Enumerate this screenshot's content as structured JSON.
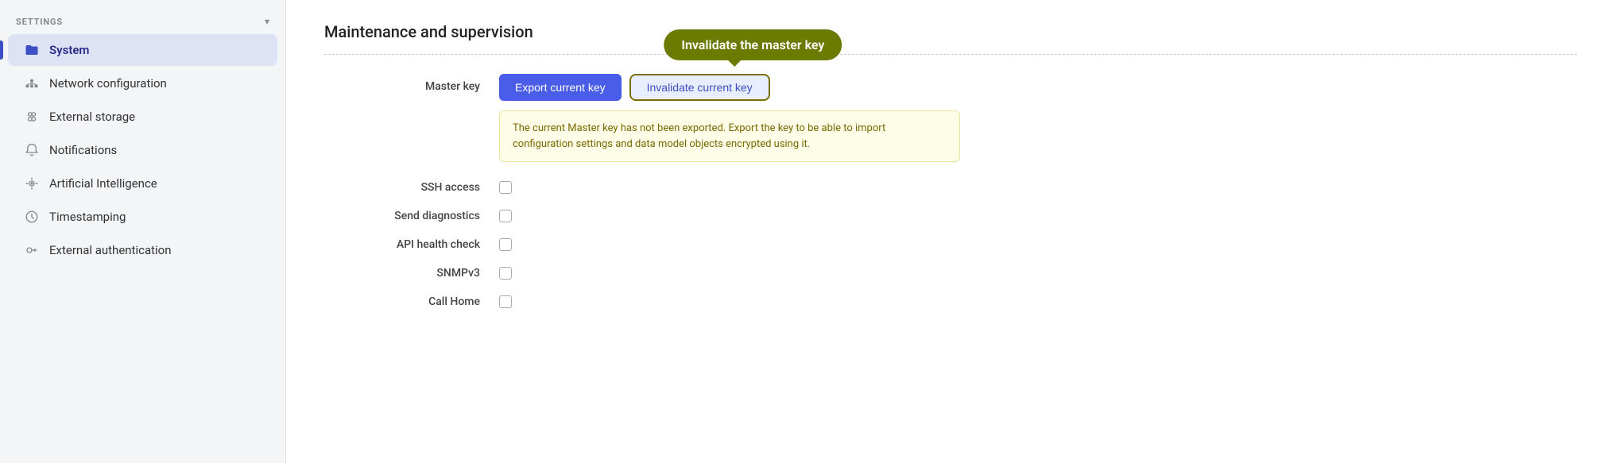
{
  "sidebar": {
    "section_label": "SETTINGS",
    "chevron": "▾",
    "items": [
      {
        "id": "system",
        "label": "System",
        "icon": "folder",
        "active": true
      },
      {
        "id": "network-config",
        "label": "Network configuration",
        "icon": "network",
        "active": false
      },
      {
        "id": "external-storage",
        "label": "External storage",
        "icon": "storage",
        "active": false
      },
      {
        "id": "notifications",
        "label": "Notifications",
        "icon": "bell",
        "active": false
      },
      {
        "id": "ai",
        "label": "Artificial Intelligence",
        "icon": "ai",
        "active": false
      },
      {
        "id": "timestamping",
        "label": "Timestamping",
        "icon": "timestamp",
        "active": false
      },
      {
        "id": "external-auth",
        "label": "External authentication",
        "icon": "key",
        "active": false
      }
    ]
  },
  "main": {
    "title": "Maintenance and supervision",
    "master_key_label": "Master key",
    "export_btn": "Export current key",
    "invalidate_btn": "Invalidate current key",
    "balloon_label": "Invalidate the master key",
    "warning_text": "The current Master key has not been exported. Export the key to be able to import configuration settings and data model objects encrypted using it.",
    "rows": [
      {
        "label": "SSH access"
      },
      {
        "label": "Send diagnostics"
      },
      {
        "label": "API health check"
      },
      {
        "label": "SNMPv3"
      },
      {
        "label": "Call Home"
      }
    ]
  }
}
